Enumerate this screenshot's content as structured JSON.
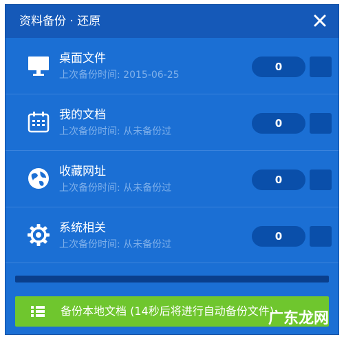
{
  "window": {
    "title": "资料备份 · 还原"
  },
  "rows": [
    {
      "name": "桌面文件",
      "subtitle": "上次备份时间: 2015-06-25",
      "count": "0",
      "icon": "monitor-icon"
    },
    {
      "name": "我的文档",
      "subtitle": "上次备份时间: 从未备份过",
      "count": "0",
      "icon": "calendar-icon"
    },
    {
      "name": "收藏网址",
      "subtitle": "上次备份时间: 从未备份过",
      "count": "0",
      "icon": "globe-icon"
    },
    {
      "name": "系统相关",
      "subtitle": "上次备份时间: 从未备份过",
      "count": "0",
      "icon": "gear-icon"
    }
  ],
  "footer": {
    "progress_percent": 0,
    "backup_button_label": "备份本地文档 (14秒后将进行自动备份文件)"
  },
  "watermark": "广东龙网",
  "colors": {
    "panel": "#1b6fd4",
    "title_bar": "#1559b8",
    "count_pill": "#0a4faa",
    "button_green": "#6fc62e"
  }
}
